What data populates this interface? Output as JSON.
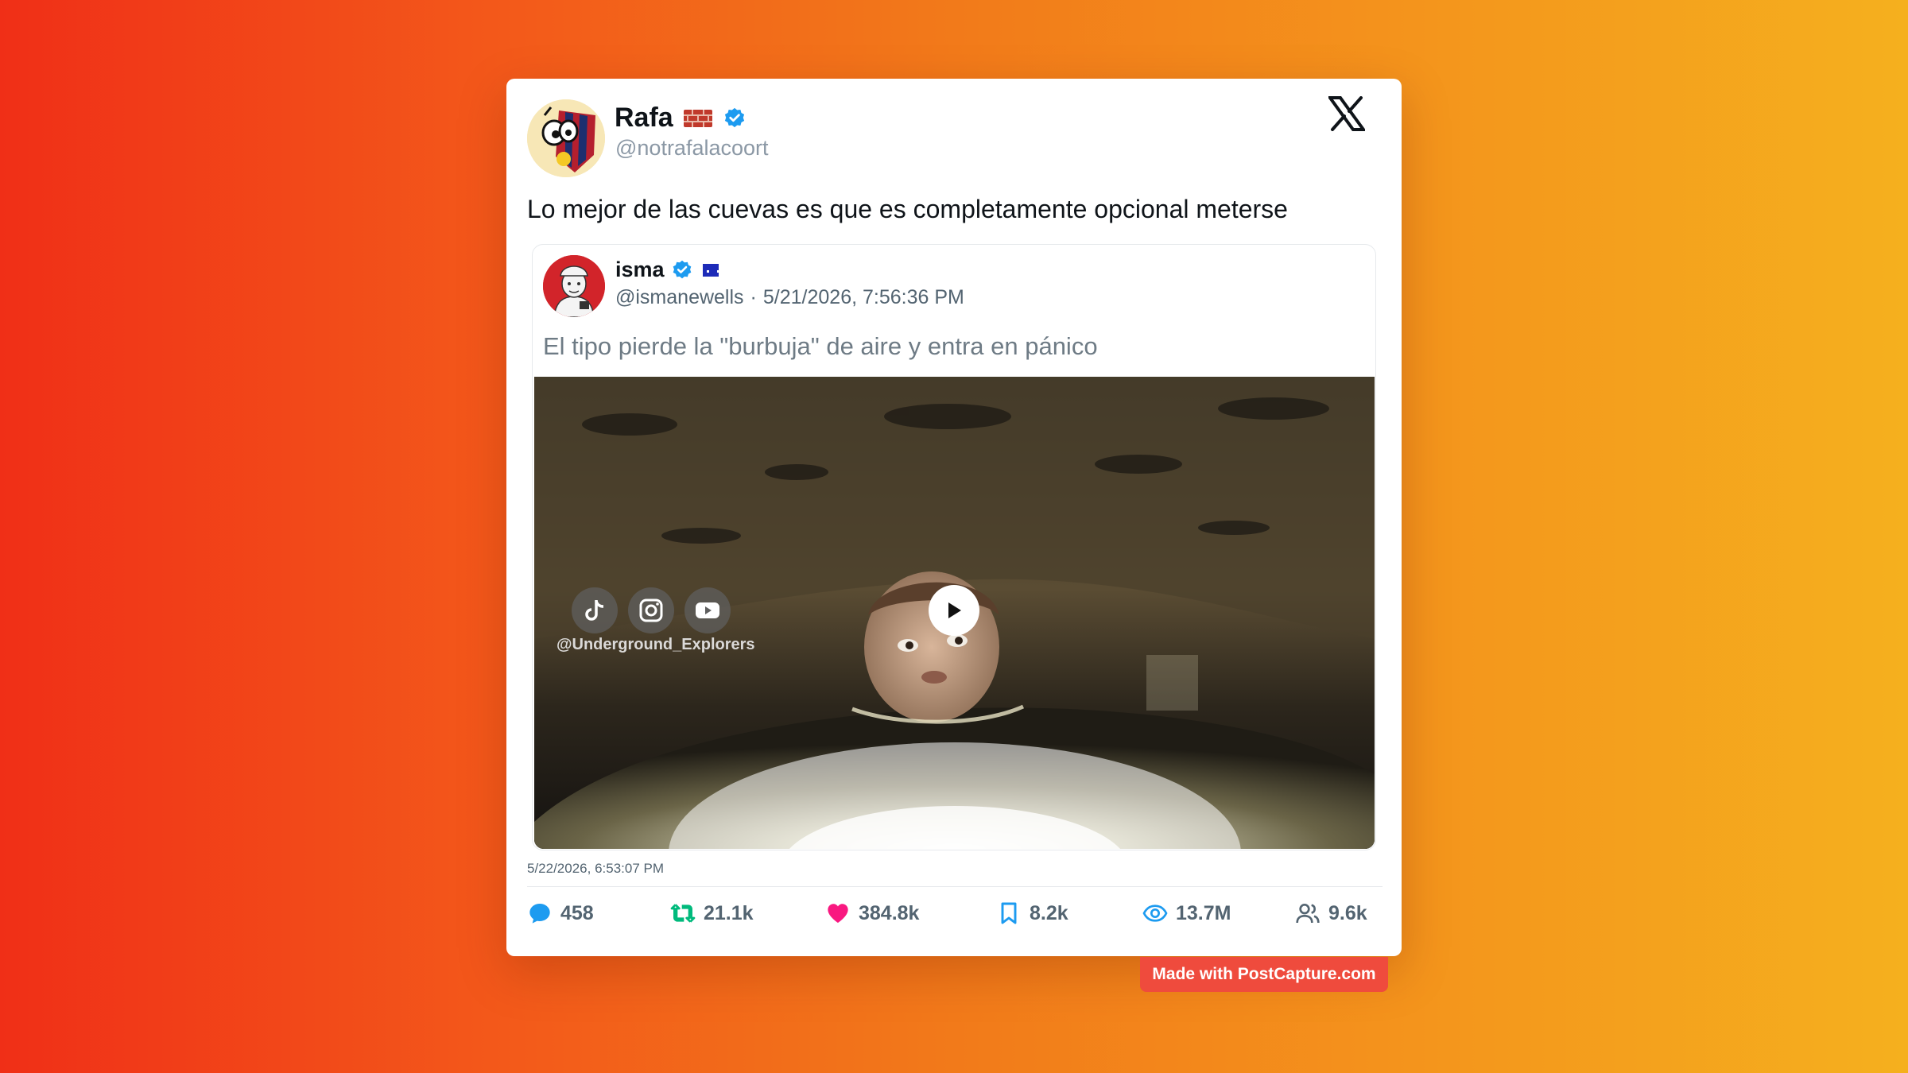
{
  "tweet": {
    "author_name": "Rafa",
    "author_handle": "@notrafalacoort",
    "text": "Lo mejor de las cuevas es que es completamente opcional meterse",
    "timestamp": "5/22/2026, 6:53:07 PM"
  },
  "quoted": {
    "author_name": "isma",
    "author_handle": "@ismanewells",
    "separator": "·",
    "date": "5/21/2026, 7:56:36 PM",
    "text": "El tipo pierde la \"burbuja\" de aire y entra en pánico",
    "video_overlay_handle": "@Underground_Explorers"
  },
  "stats": {
    "replies": "458",
    "retweets": "21.1k",
    "likes": "384.8k",
    "bookmarks": "8.2k",
    "views": "13.7M",
    "followers": "9.6k"
  },
  "icons": {
    "reply": "comment-icon",
    "retweet": "retweet-icon",
    "like": "heart-icon",
    "bookmark": "bookmark-icon",
    "views": "eye-icon",
    "followers": "people-icon"
  },
  "colors": {
    "reply": "#1d9bf0",
    "retweet": "#00ba7c",
    "like": "#f91880",
    "bookmark": "#1d9bf0",
    "views": "#1d9bf0",
    "followers": "#536471",
    "verified": "#1d9bf0",
    "badge": "#ef4b3d"
  },
  "watermark": "Made with PostCapture.com"
}
